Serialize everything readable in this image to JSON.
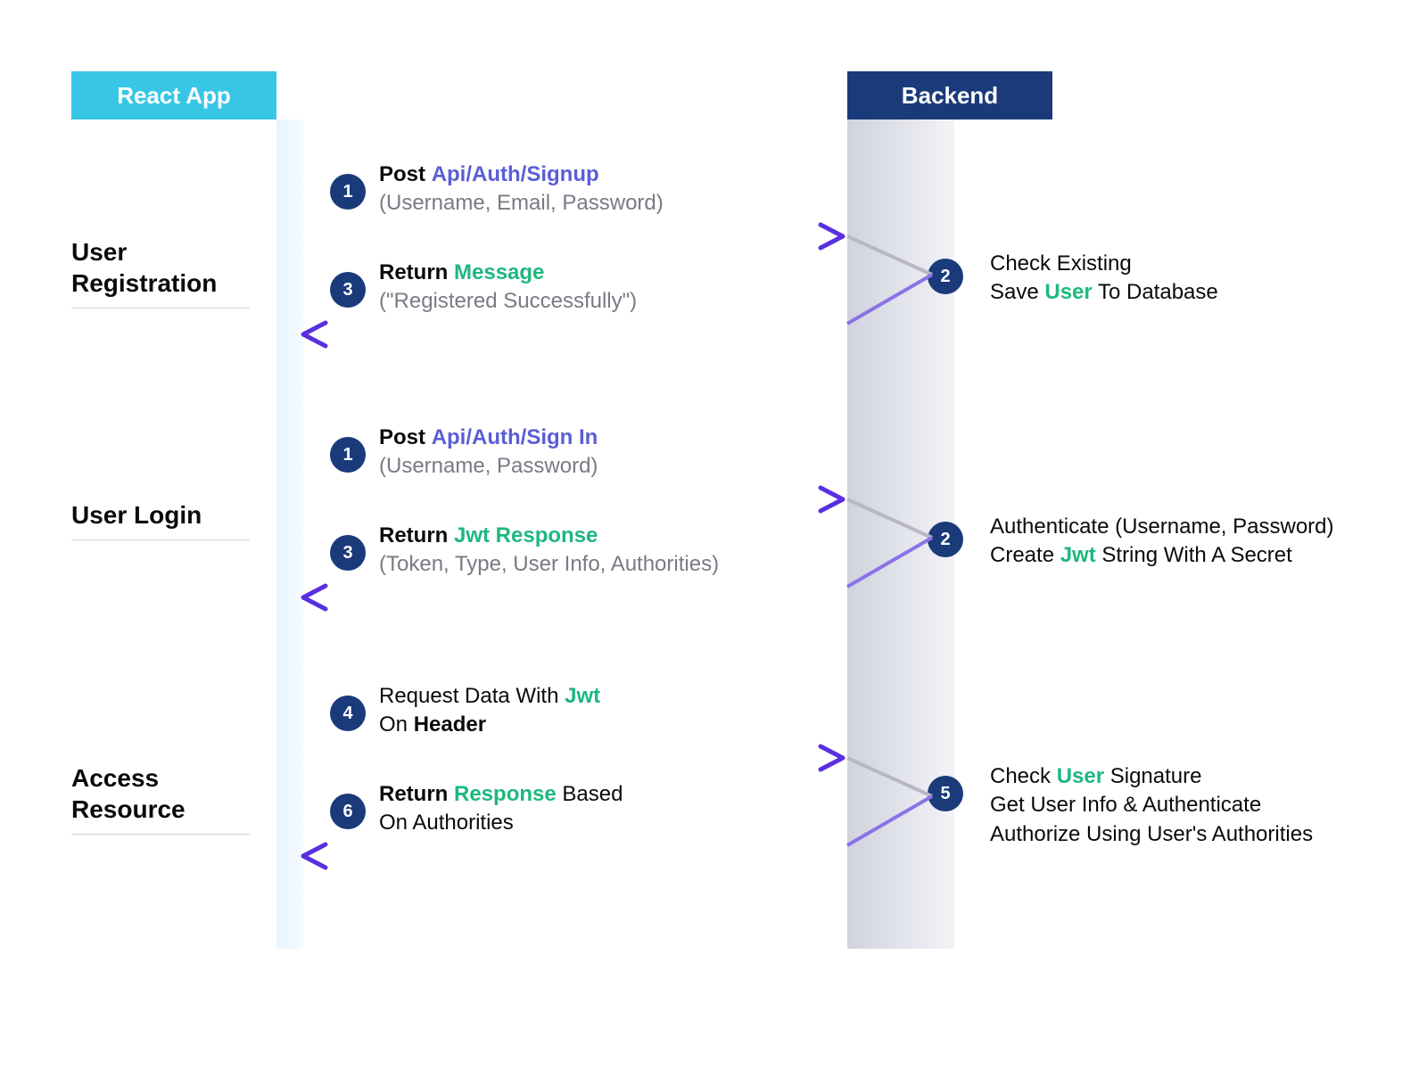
{
  "columns": {
    "frontend": "React App",
    "backend": "Backend"
  },
  "sections": [
    {
      "label": "User Registration",
      "steps": {
        "s1": {
          "num": "1",
          "title": "Post",
          "api": "Api/Auth/Signup",
          "sub": "(Username, Email, Password)"
        },
        "s2": {
          "num": "2",
          "line1_pre": "Check Existing",
          "line2_pre": "Save ",
          "line2_green": "User",
          "line2_post": " To Database"
        },
        "s3": {
          "num": "3",
          "title": "Return ",
          "green": "Message",
          "sub": "(\"Registered Successfully\")"
        }
      }
    },
    {
      "label": "User Login",
      "steps": {
        "s1": {
          "num": "1",
          "title": "Post",
          "api": "Api/Auth/Sign In",
          "sub": "(Username, Password)"
        },
        "s2": {
          "num": "2",
          "line1_pre": "Authenticate (Username, Password)",
          "line2_pre": "Create ",
          "line2_green": "Jwt",
          "line2_post": " String With A Secret"
        },
        "s3": {
          "num": "3",
          "title": "Return ",
          "green": "Jwt Response",
          "sub": "(Token, Type, User Info, Authorities)"
        }
      }
    },
    {
      "label": "Access Resource",
      "steps": {
        "s4": {
          "num": "4",
          "pre": "Request Data With ",
          "green": "Jwt",
          "line2_pre": "On ",
          "line2_bold": "Header"
        },
        "s5": {
          "num": "5",
          "l1_pre": "Check  ",
          "l1_green": "User",
          "l1_post": " Signature",
          "l2": "Get User Info & Authenticate",
          "l3": "Authorize Using User's Authorities"
        },
        "s6": {
          "num": "6",
          "title": "Return ",
          "green": "Response",
          "post": " Based",
          "line2": "On Authorities"
        }
      }
    }
  ]
}
